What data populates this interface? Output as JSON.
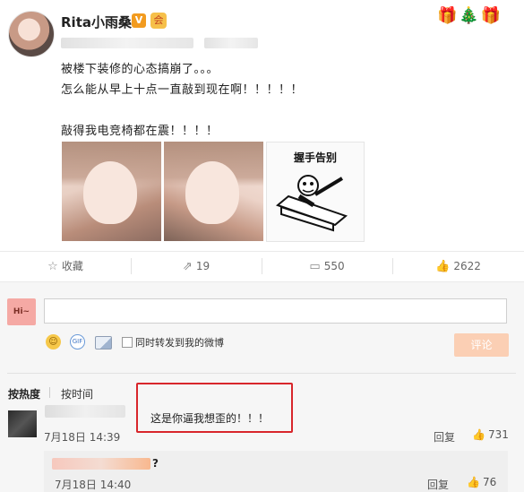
{
  "header": {
    "username": "Rita小雨桑",
    "vip_badge": "V",
    "member_badge": "会",
    "decoration": "🎁🎄🎁"
  },
  "post": {
    "line1": "被楼下装修的心态搞崩了。。。",
    "line2": "怎么能从早上十点一直敲到现在啊！！！！！",
    "line3": "敲得我电竞椅都在震！！！！",
    "meme_caption": "握手告别"
  },
  "actions": {
    "favorite": {
      "icon": "☆",
      "label": "收藏"
    },
    "forward": {
      "icon": "⇗",
      "label": "19"
    },
    "comment": {
      "icon": "▭",
      "label": "550"
    },
    "like": {
      "icon": "👍",
      "label": "2622"
    }
  },
  "composer": {
    "avatar_text": "Hi~",
    "input_value": "",
    "emoji_icon": "☺",
    "gif_icon": "GIF",
    "repost_label": "同时转发到我的微博",
    "submit_label": "评论"
  },
  "sort": {
    "hot": "按热度",
    "time": "按时间"
  },
  "comments": [
    {
      "text": "这是你逼我想歪的！！！",
      "date": "7月18日 14:39",
      "reply_label": "回复",
      "likes": "731",
      "like_icon": "👍"
    }
  ],
  "replies": [
    {
      "text": "?",
      "date": "7月18日 14:40",
      "reply_label": "回复",
      "likes": "76",
      "like_icon": "👍"
    }
  ],
  "colors": {
    "highlight": "#d8262b",
    "submit_disabled": "#fbcfb4",
    "vip": "#f29b1f"
  }
}
